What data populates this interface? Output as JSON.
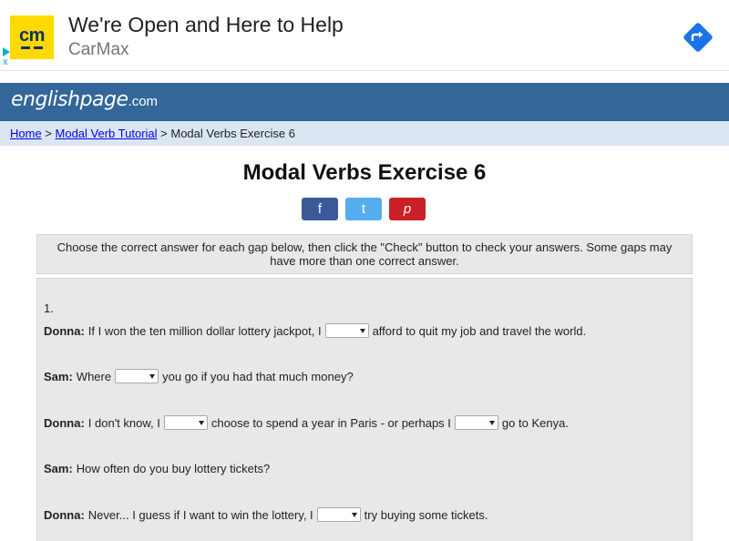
{
  "ad": {
    "logo_text": "cm",
    "title": "We're Open and Here to Help",
    "advertiser": "CarMax",
    "close": "x",
    "brand_color": "#ffd900",
    "arrow_color": "#1a73e8"
  },
  "site": {
    "logo_main": "englishpage",
    "logo_tld": ".com",
    "header_color": "#336699"
  },
  "breadcrumb": {
    "home": "Home",
    "sep1": " > ",
    "tutorial": "Modal Verb Tutorial",
    "sep2": " > ",
    "current": "Modal Verbs Exercise 6"
  },
  "page": {
    "title": "Modal Verbs Exercise 6"
  },
  "share": {
    "facebook": "f",
    "twitter": "t",
    "pinterest": "p"
  },
  "instructions": "Choose the correct answer for each gap below, then click the \"Check\" button to check your answers. Some gaps may have more than one correct answer.",
  "exercise": {
    "number": "1.",
    "lines": [
      {
        "speaker": "Donna:",
        "a": "If I won the ten million dollar lottery jackpot, I",
        "b": "afford to quit my job and travel the world."
      },
      {
        "speaker": "Sam:",
        "a": "Where",
        "b": "you go if you had that much money?"
      },
      {
        "speaker": "Donna:",
        "a": "I don't know, I",
        "b": "choose to spend a year in Paris - or perhaps I",
        "c": "go to Kenya."
      },
      {
        "speaker": "Sam:",
        "a": "How often do you buy lottery tickets?"
      },
      {
        "speaker": "Donna:",
        "a": "Never... I guess if I want to win the lottery, I",
        "b": "try buying some tickets."
      }
    ]
  }
}
